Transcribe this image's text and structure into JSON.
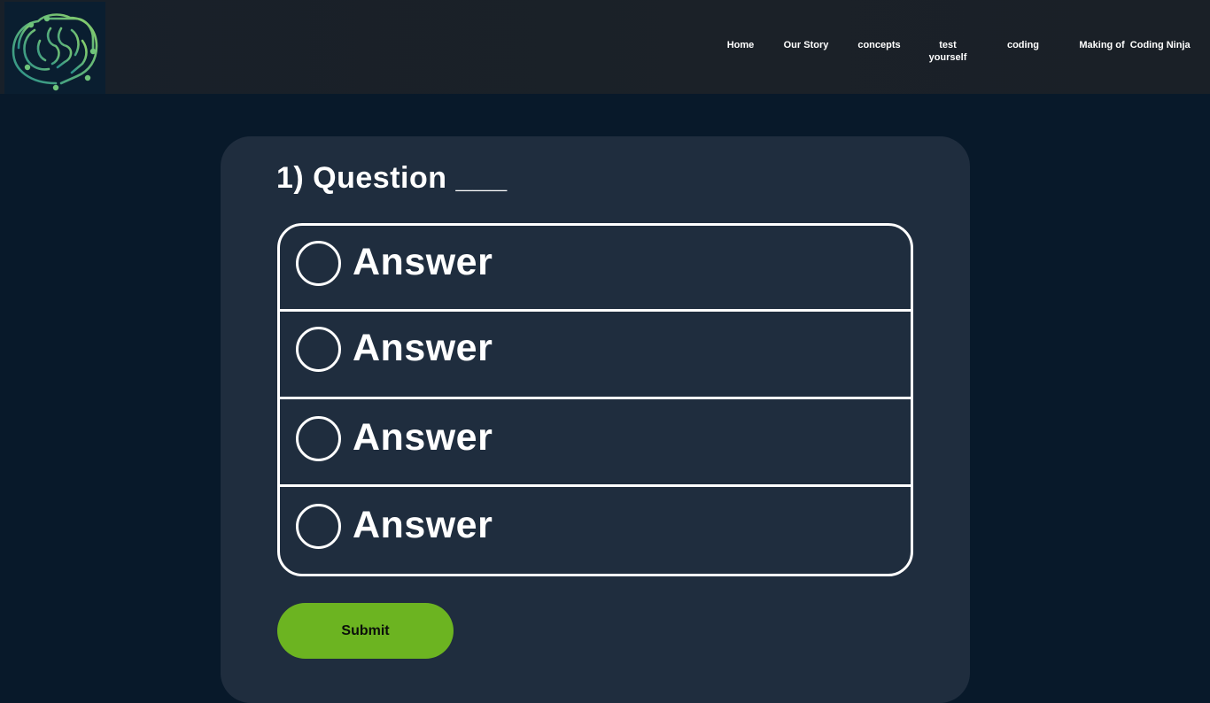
{
  "nav": {
    "items": [
      {
        "label": "Home"
      },
      {
        "label": "Our Story"
      },
      {
        "label": "concepts"
      },
      {
        "label": "test\nyourself"
      },
      {
        "label": "coding"
      },
      {
        "label": "Making of  Coding Ninja"
      }
    ]
  },
  "logo": {
    "icon": "brain-circuit-logo-icon"
  },
  "quiz": {
    "question": "1) Question ___",
    "answers": [
      {
        "label": "Answer"
      },
      {
        "label": "Answer"
      },
      {
        "label": "Answer"
      },
      {
        "label": "Answer"
      }
    ],
    "submit_label": "Submit"
  },
  "colors": {
    "page_bg": "#08192a",
    "header_bg": "#1b2128",
    "card_bg": "#1f2d3e",
    "submit_bg": "#6cb421",
    "text": "#ffffff"
  }
}
